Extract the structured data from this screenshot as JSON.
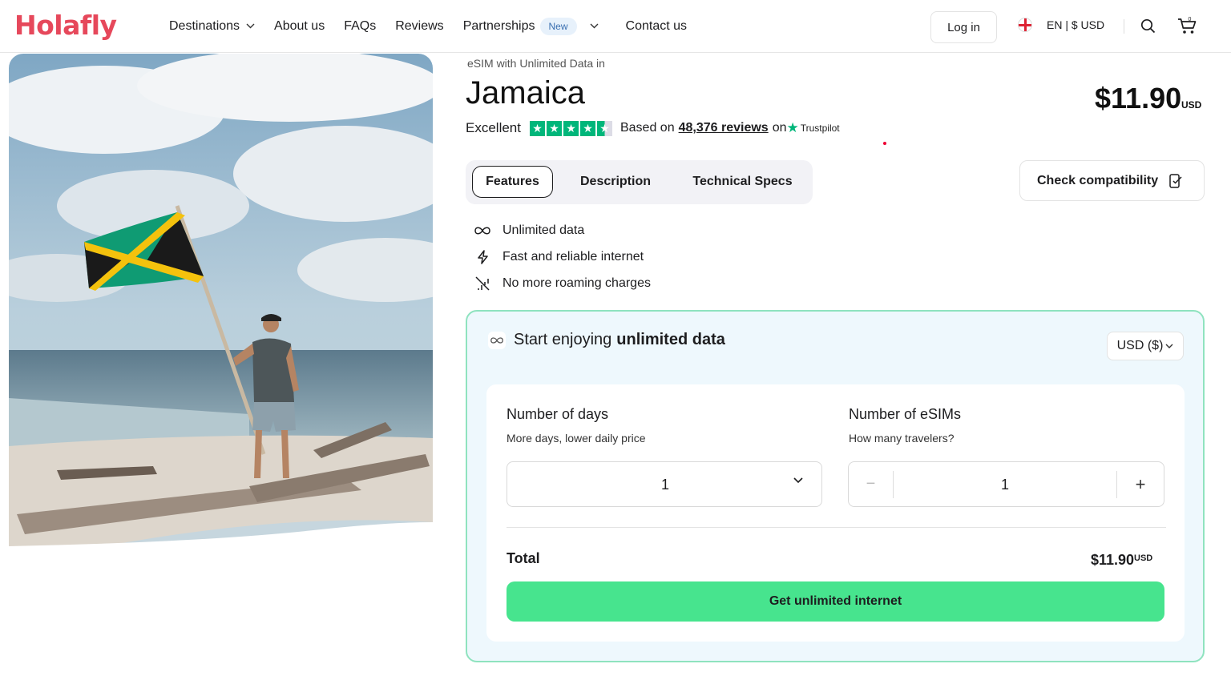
{
  "header": {
    "logo": "Holafly",
    "nav": {
      "destinations": "Destinations",
      "about": "About us",
      "faqs": "FAQs",
      "reviews": "Reviews",
      "partnerships": "Partnerships",
      "new_badge": "New",
      "contact": "Contact us"
    },
    "login": "Log in",
    "language": "EN | $ USD",
    "cart_count": "0"
  },
  "product": {
    "eyebrow": "eSIM with Unlimited Data in",
    "title": "Jamaica",
    "price": "$11.90",
    "price_currency": "USD",
    "rating_word": "Excellent",
    "based_on": "Based on",
    "reviews_link": "48,376 reviews",
    "on": "on",
    "trustpilot": "Trustpilot"
  },
  "tabs": [
    {
      "label": "Features"
    },
    {
      "label": "Description"
    },
    {
      "label": "Technical Specs"
    }
  ],
  "check_compatibility": "Check compatibility",
  "features": [
    {
      "label": "Unlimited data",
      "icon": "infinity-icon"
    },
    {
      "label": "Fast and reliable internet",
      "icon": "lightning-icon"
    },
    {
      "label": "No more roaming charges",
      "icon": "no-signal-icon"
    }
  ],
  "card": {
    "heading_prefix": "Start enjoying",
    "heading_bold": "unlimited data",
    "currency_select": "USD ($)",
    "days_title": "Number of days",
    "days_sub": "More days, lower daily price",
    "days_value": "1",
    "esims_title": "Number of eSIMs",
    "esims_sub": "How many travelers?",
    "esims_value": "1",
    "minus": "−",
    "plus": "+",
    "total_label": "Total",
    "total_value": "$11.90",
    "total_currency": "USD",
    "cta": "Get unlimited internet"
  },
  "colors": {
    "brand": "#e6485b",
    "cta": "#47e48e",
    "trustpilot": "#00b67a",
    "card_border": "#8fe3bf",
    "card_bg": "#eef8fd"
  }
}
